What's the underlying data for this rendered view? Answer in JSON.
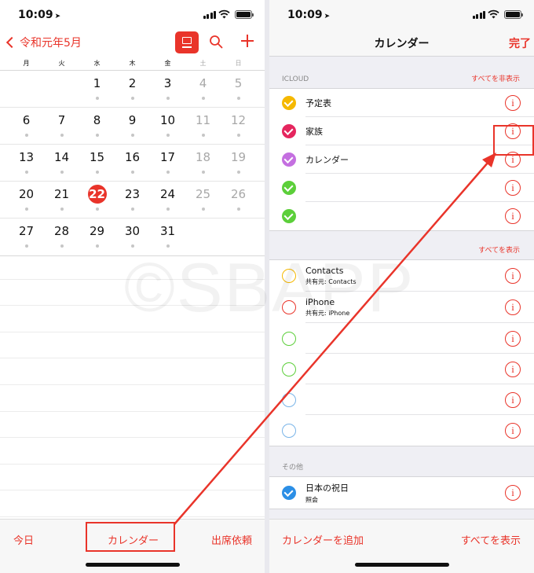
{
  "status": {
    "time": "10:09",
    "loc": "➤"
  },
  "calendar": {
    "back_label": "令和元年5月",
    "weekdays": [
      "月",
      "火",
      "水",
      "木",
      "金",
      "土",
      "日"
    ],
    "weeks": [
      [
        "",
        "",
        "1",
        "2",
        "3",
        "4",
        "5"
      ],
      [
        "6",
        "7",
        "8",
        "9",
        "10",
        "11",
        "12"
      ],
      [
        "13",
        "14",
        "15",
        "16",
        "17",
        "18",
        "19"
      ],
      [
        "20",
        "21",
        "22",
        "23",
        "24",
        "25",
        "26"
      ],
      [
        "27",
        "28",
        "29",
        "30",
        "31",
        "",
        ""
      ]
    ],
    "today": "22",
    "toolbar": {
      "today": "今日",
      "calendars": "カレンダー",
      "inbox": "出席依頼"
    }
  },
  "calendars_screen": {
    "title": "カレンダー",
    "done": "完了",
    "sections": [
      {
        "header": "ICLOUD",
        "action": "すべてを非表示",
        "items": [
          {
            "name": "予定表",
            "sub": "",
            "color": "#f5b800",
            "checked": true
          },
          {
            "name": "家族",
            "sub": "",
            "color": "#e5265e",
            "checked": true
          },
          {
            "name": "カレンダー",
            "sub": "",
            "color": "#c46fe0",
            "checked": true
          },
          {
            "name": "",
            "sub": "",
            "color": "#5ccf3a",
            "checked": true
          },
          {
            "name": "",
            "sub": "",
            "color": "#5ccf3a",
            "checked": true
          }
        ]
      },
      {
        "header": "",
        "action": "すべてを表示",
        "items": [
          {
            "name": "Contacts",
            "sub": "共有元: Contacts",
            "color": "#f5b800",
            "checked": false
          },
          {
            "name": "iPhone",
            "sub": "共有元: iPhone",
            "color": "#e9342a",
            "checked": false
          },
          {
            "name": "",
            "sub": "",
            "color": "#5ccf3a",
            "checked": false
          },
          {
            "name": "",
            "sub": "",
            "color": "#5ccf3a",
            "checked": false
          },
          {
            "name": "",
            "sub": "",
            "color": "#79b4e8",
            "checked": false
          },
          {
            "name": "",
            "sub": "",
            "color": "#79b4e8",
            "checked": false
          }
        ]
      },
      {
        "header": "その他",
        "action": "",
        "items": [
          {
            "name": "日本の祝日",
            "sub": "照会",
            "color": "#2c8fe6",
            "checked": true
          }
        ]
      }
    ],
    "toolbar": {
      "add": "カレンダーを追加",
      "show_all": "すべてを表示"
    }
  },
  "info_glyph": "i",
  "watermark": "©SBAPP",
  "accent": "#e9342a"
}
